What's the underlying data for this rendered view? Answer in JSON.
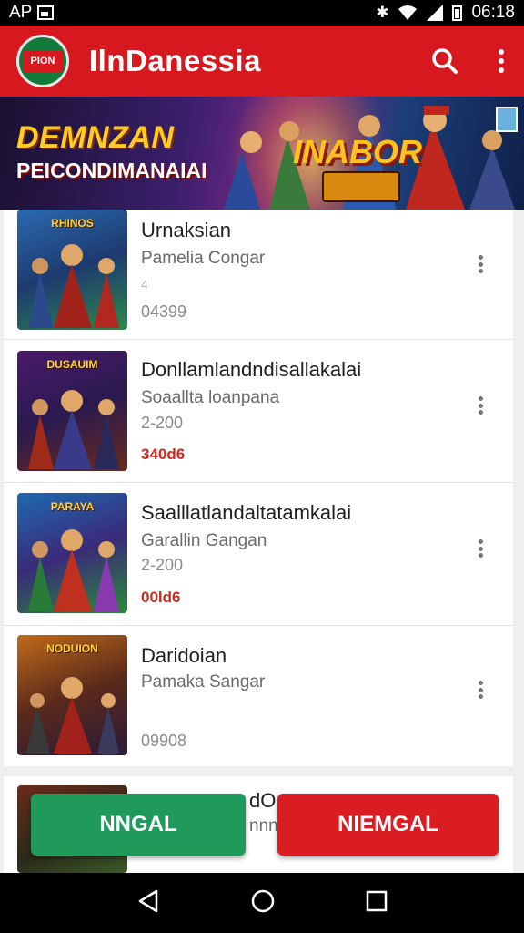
{
  "status_bar": {
    "carrier": "AP",
    "time": "06:18",
    "icons": [
      "image-icon",
      "nfc-icon",
      "wifi-icon",
      "signal-icon",
      "battery-icon"
    ]
  },
  "app_bar": {
    "logo_text": "PION",
    "title": "IlnDanessia",
    "icons": [
      "search-icon",
      "more-vert-icon"
    ],
    "color": "#d7191f"
  },
  "banner": {
    "title": "DEMNZAN",
    "subtitle": "PEICONDIMANAIAI",
    "logo_text": "INABOR"
  },
  "items": [
    {
      "thumb_title": "RHINOS",
      "title": "Urnaksian",
      "subtitle": "Pamelia Congar",
      "extra": "4",
      "meta": "04399",
      "price": ""
    },
    {
      "thumb_title": "DUSAUIM",
      "title": "Donllamlandndisallakalai",
      "subtitle": "Soaallta loanpana",
      "extra": "",
      "meta": "2-200",
      "price": "340d6"
    },
    {
      "thumb_title": "PARAYA",
      "title": "Saalllatlandaltatamkalai",
      "subtitle": "Garallin Gangan",
      "extra": "",
      "meta": "2-200",
      "price": "00ld6"
    },
    {
      "thumb_title": "NODUION",
      "title": "Daridoian",
      "subtitle": "Pamaka Sangar",
      "extra": "",
      "meta": "09908",
      "price": ""
    },
    {
      "thumb_title": "",
      "title": "dO",
      "subtitle": "nnn",
      "extra": "",
      "meta": "",
      "price": ""
    }
  ],
  "buttons": {
    "left_label": "NNGAL",
    "right_label": "NIEMGAL",
    "left_color": "#1f9a5a",
    "right_color": "#d91d22"
  },
  "nav_bar": {
    "icons": [
      "back-icon",
      "home-icon",
      "recents-icon"
    ]
  }
}
